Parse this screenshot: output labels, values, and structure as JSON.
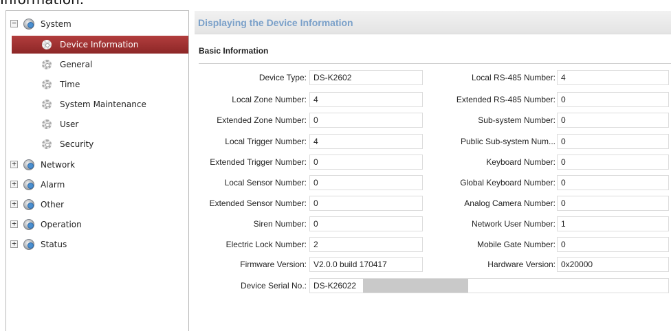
{
  "caption": "Information.",
  "sidebar": {
    "groups": [
      {
        "label": "System",
        "expander": "−",
        "icon": "gear-globe-icon"
      },
      {
        "label": "Network",
        "expander": "+",
        "icon": "gear-globe-icon"
      },
      {
        "label": "Alarm",
        "expander": "+",
        "icon": "gear-globe-icon"
      },
      {
        "label": "Other",
        "expander": "+",
        "icon": "gear-globe-icon"
      },
      {
        "label": "Operation",
        "expander": "+",
        "icon": "gear-globe-icon"
      },
      {
        "label": "Status",
        "expander": "+",
        "icon": "gear-globe-icon"
      }
    ],
    "system_items": [
      {
        "label": "Device Information",
        "active": true,
        "icon": "gear-icon"
      },
      {
        "label": "General",
        "icon": "gear-icon"
      },
      {
        "label": "Time",
        "icon": "gear-icon"
      },
      {
        "label": "System Maintenance",
        "icon": "gear-icon"
      },
      {
        "label": "User",
        "icon": "gear-icon"
      },
      {
        "label": "Security",
        "icon": "gear-icon"
      }
    ]
  },
  "header": {
    "title": "Displaying the Device Information"
  },
  "section": {
    "title": "Basic Information"
  },
  "fields_left": [
    {
      "label": "Device Type:",
      "value": "DS-K2602"
    },
    {
      "label": "Local Zone Number:",
      "value": "4"
    },
    {
      "label": "Extended Zone Number:",
      "value": "0"
    },
    {
      "label": "Local Trigger Number:",
      "value": "4"
    },
    {
      "label": "Extended Trigger Number:",
      "value": "0"
    },
    {
      "label": "Local Sensor Number:",
      "value": "0"
    },
    {
      "label": "Extended Sensor Number:",
      "value": "0"
    },
    {
      "label": "Siren Number:",
      "value": "0"
    },
    {
      "label": "Electric Lock Number:",
      "value": "2"
    },
    {
      "label": "Firmware Version:",
      "value": "V2.0.0 build 170417"
    }
  ],
  "fields_right": [
    {
      "label": "Local RS-485 Number:",
      "value": "4"
    },
    {
      "label": "Extended RS-485 Number:",
      "value": "0"
    },
    {
      "label": "Sub-system Number:",
      "value": "0"
    },
    {
      "label": "Public Sub-system Num...",
      "value": "0"
    },
    {
      "label": "Keyboard Number:",
      "value": "0"
    },
    {
      "label": "Global Keyboard Number:",
      "value": "0"
    },
    {
      "label": "Analog Camera Number:",
      "value": "0"
    },
    {
      "label": "Network User Number:",
      "value": "1"
    },
    {
      "label": "Mobile Gate Number:",
      "value": "0"
    },
    {
      "label": "Hardware Version:",
      "value": "0x20000"
    }
  ],
  "serial": {
    "label": "Device Serial No.:",
    "value": "DS-K26022"
  },
  "colors": {
    "active_item": "#a33333",
    "header_title": "#7aa0c9"
  }
}
